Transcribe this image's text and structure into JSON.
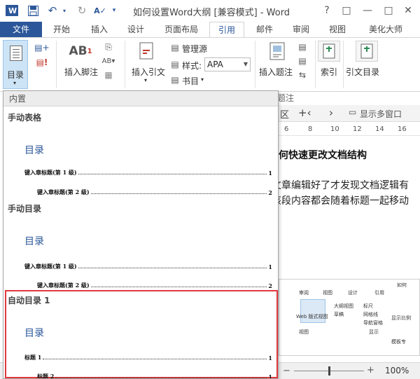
{
  "window": {
    "title": "如何设置Word大纲 [兼容模式] - Word",
    "help": "?",
    "ribbon_display": "□",
    "minimize": "—",
    "restore": "□",
    "close": "✕"
  },
  "tabs": [
    "文件",
    "开始",
    "插入",
    "设计",
    "页面布局",
    "引用",
    "邮件",
    "审阅",
    "视图",
    "美化大师"
  ],
  "ribbon": {
    "toc_label": "目录",
    "footnote_label": "插入脚注",
    "footnote_icon_text": "AB",
    "citation_label": "插入引文",
    "manage_sources": "管理源",
    "style_label": "样式:",
    "style_value": "APA",
    "bibliography": "书目",
    "caption_label": "插入题注",
    "index_label": "索引",
    "toa_label": "引文目录",
    "group_caption_label": "题注"
  },
  "document": {
    "nav_text": "区",
    "multi_window": "显示多窗口",
    "ruler": [
      "6",
      "8",
      "10",
      "12",
      "14",
      "16"
    ],
    "heading": "何快速更改文档结构",
    "line1": "文章编辑好了才发现文档逻辑有",
    "line2": "该段内容都会随着标题一起移动",
    "embed": {
      "tabs": [
        "审阅",
        "视图",
        "设计",
        "引用",
        "如何"
      ],
      "web_layout": "Web 版式视图",
      "outline": "大纲视图",
      "draft": "草稿",
      "ruler": "标尺",
      "gridlines": "网格线",
      "nav_pane": "导航窗格",
      "show": "显示",
      "view": "视图",
      "zoom": "显示比例",
      "template": "模板专"
    }
  },
  "status": {
    "zoom": "100%"
  },
  "gallery": {
    "header": "内置",
    "items": [
      {
        "title": "手动表格",
        "toc_heading": "目录",
        "lines": [
          {
            "label": "键入章标题(第 1 级)",
            "page": "1"
          },
          {
            "label": "键入章标题(第 2 级)",
            "page": "2"
          }
        ]
      },
      {
        "title": "手动目录",
        "toc_heading": "目录",
        "lines": [
          {
            "label": "键入章标题(第 1 级)",
            "page": "1"
          },
          {
            "label": "键入章标题(第 2 级)",
            "page": "2"
          }
        ]
      },
      {
        "title": "自动目录 1",
        "toc_heading": "目录",
        "lines": [
          {
            "label": "标题 1",
            "page": "1"
          },
          {
            "label": "标题 2",
            "page": "1"
          }
        ]
      }
    ]
  },
  "colors": {
    "accent": "#2b579a",
    "highlight": "#e0393e"
  }
}
